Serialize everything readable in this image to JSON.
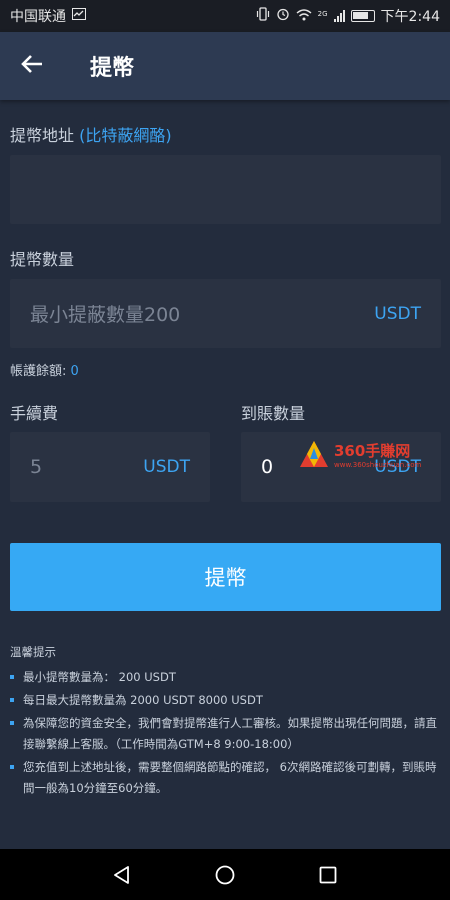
{
  "status_bar": {
    "carrier": "中国联通",
    "network_badge": "2G",
    "time": "下午2:44"
  },
  "header": {
    "title": "提幣"
  },
  "address": {
    "label": "提幣地址",
    "network_hint": "(比特蔽網酪)",
    "value": ""
  },
  "amount": {
    "label": "提幣數量",
    "placeholder": "最小提蔽數量200",
    "unit": "USDT"
  },
  "balance": {
    "label": "帳護餘額:",
    "value": "0"
  },
  "fee": {
    "label": "手續費",
    "value": "5",
    "unit": "USDT"
  },
  "received": {
    "label": "到賬數量",
    "value": "0",
    "unit": "USDT"
  },
  "submit_label": "提幣",
  "tips": {
    "title": "溫馨提示",
    "items": [
      "最小提幣數量為： 200 USDT",
      "每日最大提幣數量為 2000 USDT 8000 USDT",
      "為保障您的資金安全，我們會對提幣進行人工審核。如果提幣出現任何問題，請直接聯繫線上客服。（工作時間為GTM+8 9:00-18:00）",
      "您充值到上述地址後，需要整個網路節點的確認， 6次網路確認後可劃轉，到賬時間一般為10分鐘至60分鐘。"
    ]
  },
  "watermark": {
    "text": "360手賺网",
    "sub": "www.360shouzhuan.com"
  },
  "colors": {
    "accent": "#3da4f2",
    "button": "#36a9f4",
    "background": "#232c3d",
    "header": "#2d3a52"
  }
}
